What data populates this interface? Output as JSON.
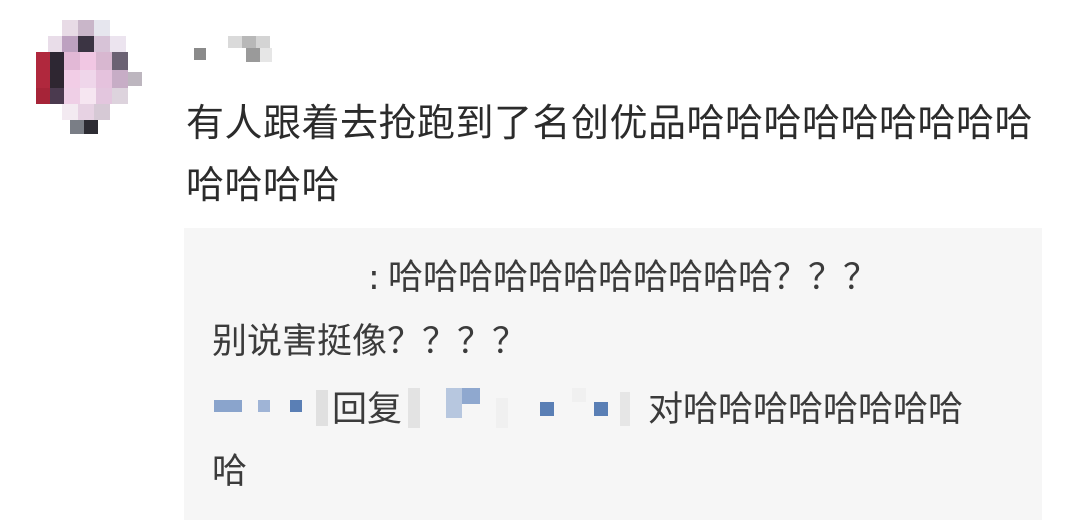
{
  "comment": {
    "username": "",
    "text": "有人跟着去抢跑到了名创优品哈哈哈哈哈哈哈哈哈哈哈哈哈"
  },
  "replies": [
    {
      "author": "",
      "separator": ":",
      "text_line1": "哈哈哈哈哈哈哈哈哈哈哈？？？",
      "text_line2": "别说害挺像？？？？"
    },
    {
      "author": "",
      "reply_word": "回复",
      "target_author": "",
      "text_line1": "对哈哈哈哈哈哈哈哈",
      "text_line2": "哈"
    }
  ],
  "colors": {
    "background": "#ffffff",
    "reply_background": "#f6f6f6",
    "text": "#333333",
    "avatar_accent": "#b0283d",
    "mosaic_blue": "#5a7fb5"
  }
}
